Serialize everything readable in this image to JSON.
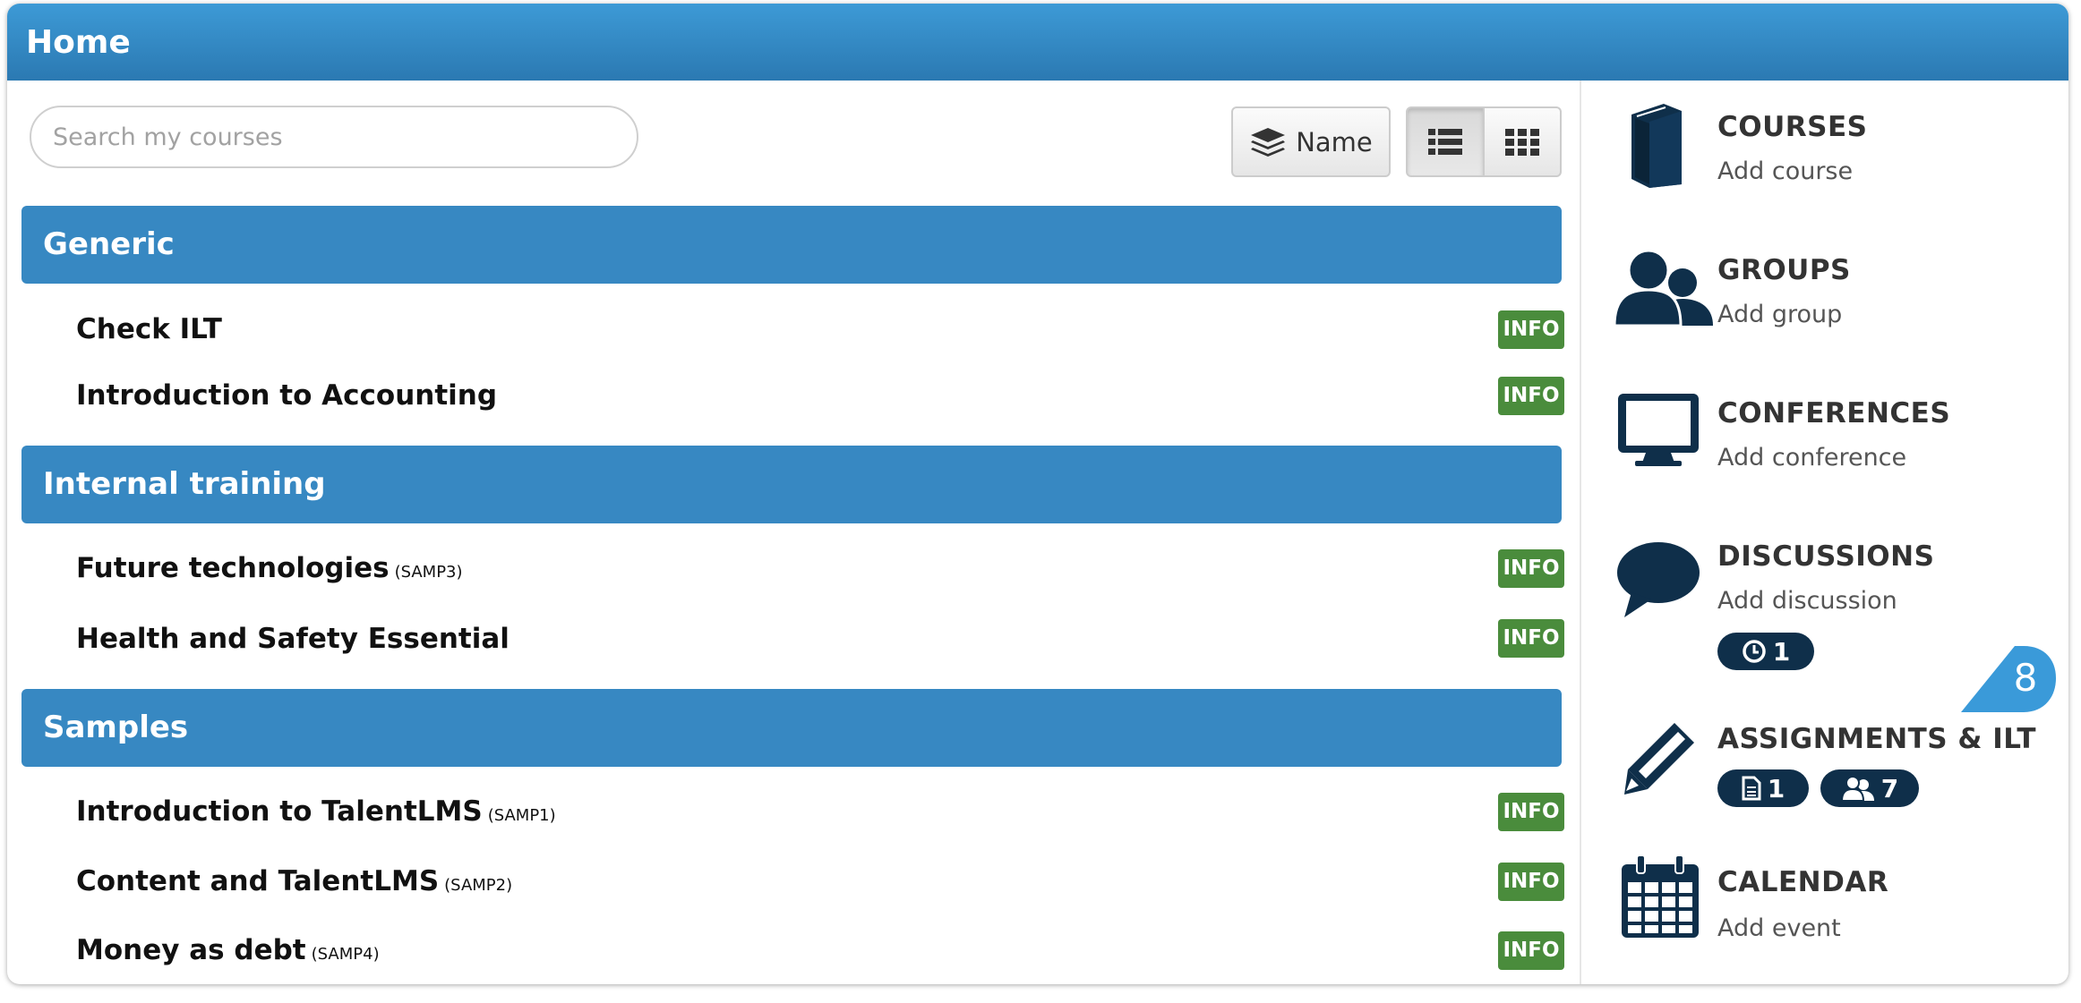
{
  "header": {
    "title": "Home"
  },
  "search": {
    "placeholder": "Search my courses",
    "value": ""
  },
  "toolbar": {
    "sort_label": "Name"
  },
  "categories": [
    {
      "name": "Generic",
      "courses": [
        {
          "name": "Check ILT",
          "code": "",
          "badge": "INFO"
        },
        {
          "name": "Introduction to Accounting",
          "code": "",
          "badge": "INFO"
        }
      ]
    },
    {
      "name": "Internal training",
      "courses": [
        {
          "name": "Future technologies",
          "code": "(SAMP3)",
          "badge": "INFO"
        },
        {
          "name": "Health and Safety Essential",
          "code": "",
          "badge": "INFO"
        }
      ]
    },
    {
      "name": "Samples",
      "courses": [
        {
          "name": "Introduction to TalentLMS",
          "code": "(SAMP1)",
          "badge": "INFO"
        },
        {
          "name": "Content and TalentLMS",
          "code": "(SAMP2)",
          "badge": "INFO"
        },
        {
          "name": "Money as debt",
          "code": "(SAMP4)",
          "badge": "INFO"
        }
      ]
    }
  ],
  "sidebar": {
    "courses": {
      "title": "COURSES",
      "link": "Add course",
      "icon": "book-icon"
    },
    "groups": {
      "title": "GROUPS",
      "link": "Add group",
      "icon": "users-icon"
    },
    "conferences": {
      "title": "CONFERENCES",
      "link": "Add conference",
      "icon": "monitor-icon"
    },
    "discussions": {
      "title": "DISCUSSIONS",
      "link": "Add discussion",
      "icon": "comment-icon",
      "pending_count": "1"
    },
    "assignments": {
      "title": "ASSIGNMENTS & ILT",
      "icon": "pencil-icon",
      "assignments_count": "1",
      "ilt_count": "7"
    },
    "calendar": {
      "title": "CALENDAR",
      "link": "Add event",
      "icon": "calendar-icon"
    }
  },
  "tour_badge": "8",
  "colors": {
    "header": "#3188c4",
    "category": "#3788c2",
    "info_badge": "#4a8c3c",
    "icon_dark": "#0f2f4a"
  }
}
